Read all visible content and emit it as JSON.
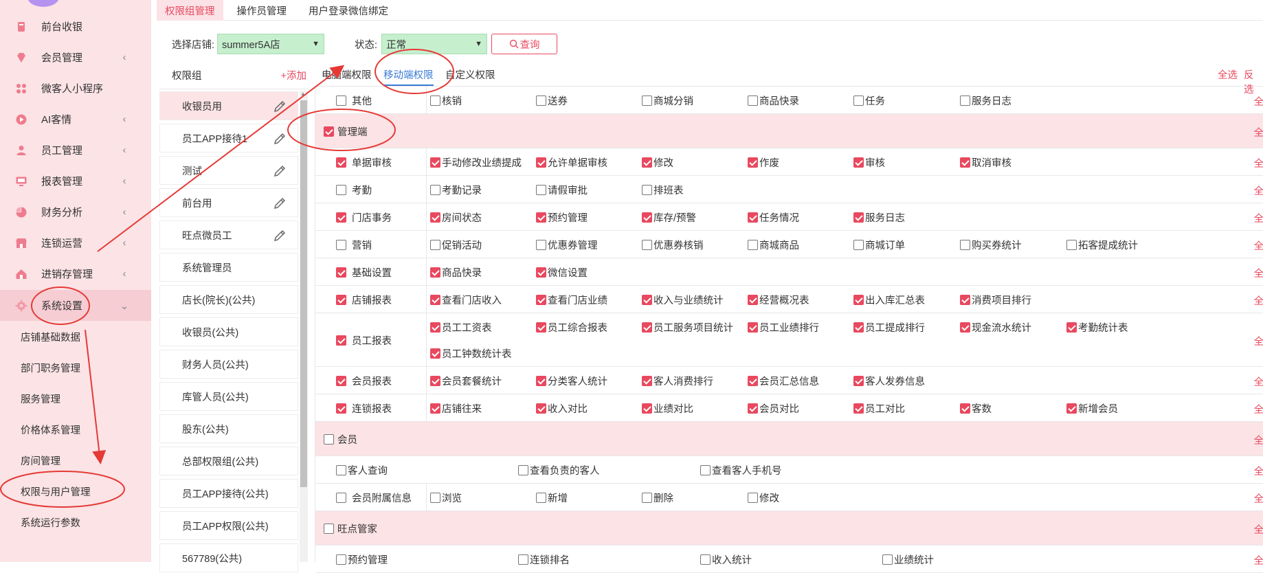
{
  "sidebar": {
    "items": [
      {
        "label": "前台收银",
        "icon": "cashier-icon"
      },
      {
        "label": "会员管理",
        "icon": "diamond-icon"
      },
      {
        "label": "微客人小程序",
        "icon": "mini-program-icon"
      },
      {
        "label": "AI客情",
        "icon": "play-circle-icon"
      },
      {
        "label": "员工管理",
        "icon": "user-icon"
      },
      {
        "label": "报表管理",
        "icon": "monitor-icon"
      },
      {
        "label": "财务分析",
        "icon": "pie-chart-icon"
      },
      {
        "label": "连锁运营",
        "icon": "store-icon"
      },
      {
        "label": "进销存管理",
        "icon": "house-icon"
      },
      {
        "label": "系统设置",
        "icon": "gear-icon"
      }
    ],
    "sub_items": [
      "店铺基础数据",
      "部门职务管理",
      "服务管理",
      "价格体系管理",
      "房间管理",
      "权限与用户管理",
      "系统运行参数"
    ],
    "chevron_collapsed": "‹",
    "chevron_expanded": "⌄"
  },
  "top_tabs": [
    "权限组管理",
    "操作员管理",
    "用户登录微信绑定"
  ],
  "filter": {
    "store_label": "选择店铺:",
    "store_value": "summer5A店",
    "status_label": "状态:",
    "status_value": "正常",
    "query_label": "查询"
  },
  "groups": {
    "header": "权限组",
    "add": "+添加",
    "items": [
      "收银员用",
      "员工APP接待1",
      "测试",
      "前台用",
      "旺点微员工",
      "系统管理员",
      "店长(院长)(公共)",
      "收银员(公共)",
      "财务人员(公共)",
      "库管人员(公共)",
      "股东(公共)",
      "总部权限组(公共)",
      "员工APP接待(公共)",
      "员工APP权限(公共)",
      "567789(公共)"
    ]
  },
  "perm_tabs": [
    "电脑端权限",
    "移动端权限",
    "自定义权限"
  ],
  "select_all": "全选",
  "invert": "反选",
  "row_select_all": "全",
  "rows": [
    {
      "type": "row",
      "label": "其他",
      "checked": false,
      "options": [
        {
          "t": "核销",
          "c": false
        },
        {
          "t": "送券",
          "c": false
        },
        {
          "t": "商城分销",
          "c": false
        },
        {
          "t": "商品快录",
          "c": false
        },
        {
          "t": "任务",
          "c": false
        },
        {
          "t": "服务日志",
          "c": false
        }
      ]
    },
    {
      "type": "section",
      "label": "管理端",
      "checked": true
    },
    {
      "type": "row",
      "label": "单据审核",
      "checked": true,
      "options": [
        {
          "t": "手动修改业绩提成",
          "c": true
        },
        {
          "t": "允许单据审核",
          "c": true
        },
        {
          "t": "修改",
          "c": true
        },
        {
          "t": "作废",
          "c": true
        },
        {
          "t": "审核",
          "c": true
        },
        {
          "t": "取消审核",
          "c": true
        }
      ]
    },
    {
      "type": "row",
      "label": "考勤",
      "checked": false,
      "options": [
        {
          "t": "考勤记录",
          "c": false
        },
        {
          "t": "请假审批",
          "c": false
        },
        {
          "t": "排班表",
          "c": false
        }
      ]
    },
    {
      "type": "row",
      "label": "门店事务",
      "checked": true,
      "options": [
        {
          "t": "房间状态",
          "c": true
        },
        {
          "t": "预约管理",
          "c": true
        },
        {
          "t": "库存/预警",
          "c": true
        },
        {
          "t": "任务情况",
          "c": true
        },
        {
          "t": "服务日志",
          "c": true
        }
      ]
    },
    {
      "type": "row",
      "label": "营销",
      "checked": false,
      "options": [
        {
          "t": "促销活动",
          "c": false
        },
        {
          "t": "优惠券管理",
          "c": false
        },
        {
          "t": "优惠券核销",
          "c": false
        },
        {
          "t": "商城商品",
          "c": false
        },
        {
          "t": "商城订单",
          "c": false
        },
        {
          "t": "购买券统计",
          "c": false
        },
        {
          "t": "拓客提成统计",
          "c": false
        }
      ]
    },
    {
      "type": "row",
      "label": "基础设置",
      "checked": true,
      "options": [
        {
          "t": "商品快录",
          "c": true
        },
        {
          "t": "微信设置",
          "c": true
        }
      ]
    },
    {
      "type": "row",
      "label": "店铺报表",
      "checked": true,
      "options": [
        {
          "t": "查看门店收入",
          "c": true
        },
        {
          "t": "查看门店业绩",
          "c": true
        },
        {
          "t": "收入与业绩统计",
          "c": true
        },
        {
          "t": "经营概况表",
          "c": true
        },
        {
          "t": "出入库汇总表",
          "c": true
        },
        {
          "t": "消费项目排行",
          "c": true
        }
      ]
    },
    {
      "type": "row2",
      "label": "员工报表",
      "checked": true,
      "options": [
        {
          "t": "员工工资表",
          "c": true
        },
        {
          "t": "员工综合报表",
          "c": true
        },
        {
          "t": "员工服务项目统计",
          "c": true
        },
        {
          "t": "员工业绩排行",
          "c": true
        },
        {
          "t": "员工提成排行",
          "c": true
        },
        {
          "t": "现金流水统计",
          "c": true
        },
        {
          "t": "考勤统计表",
          "c": true
        },
        {
          "t": "员工钟数统计表",
          "c": true
        }
      ]
    },
    {
      "type": "row",
      "label": "会员报表",
      "checked": true,
      "options": [
        {
          "t": "会员套餐统计",
          "c": true
        },
        {
          "t": "分类客人统计",
          "c": true
        },
        {
          "t": "客人消费排行",
          "c": true
        },
        {
          "t": "会员汇总信息",
          "c": true
        },
        {
          "t": "客人发券信息",
          "c": true
        }
      ]
    },
    {
      "type": "row",
      "label": "连锁报表",
      "checked": true,
      "options": [
        {
          "t": "店铺往来",
          "c": true
        },
        {
          "t": "收入对比",
          "c": true
        },
        {
          "t": "业绩对比",
          "c": true
        },
        {
          "t": "会员对比",
          "c": true
        },
        {
          "t": "员工对比",
          "c": true
        },
        {
          "t": "客数",
          "c": true
        },
        {
          "t": "新增会员",
          "c": true
        }
      ]
    },
    {
      "type": "section",
      "label": "会员",
      "checked": false
    },
    {
      "type": "wide",
      "options": [
        {
          "t": "客人查询",
          "c": false
        },
        {
          "t": "查看负责的客人",
          "c": false
        },
        {
          "t": "查看客人手机号",
          "c": false
        }
      ]
    },
    {
      "type": "row",
      "label": "会员附属信息",
      "checked": false,
      "options": [
        {
          "t": "浏览",
          "c": false
        },
        {
          "t": "新增",
          "c": false
        },
        {
          "t": "删除",
          "c": false
        },
        {
          "t": "修改",
          "c": false
        }
      ]
    },
    {
      "type": "section",
      "label": "旺点管家",
      "checked": false
    },
    {
      "type": "wide",
      "options": [
        {
          "t": "预约管理",
          "c": false
        },
        {
          "t": "连锁排名",
          "c": false
        },
        {
          "t": "收入统计",
          "c": false
        },
        {
          "t": "业绩统计",
          "c": false
        }
      ]
    }
  ]
}
